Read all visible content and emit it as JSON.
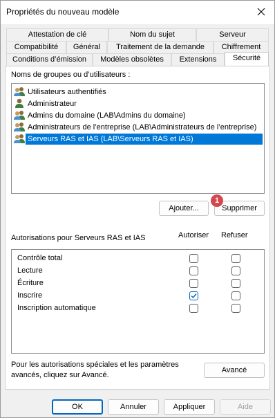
{
  "window": {
    "title": "Propriétés du nouveau modèle"
  },
  "tabs": {
    "row1": [
      "Attestation de clé",
      "Nom du sujet",
      "Serveur"
    ],
    "row2": [
      "Compatibilité",
      "Général",
      "Traitement de la demande",
      "Chiffrement"
    ],
    "row3": [
      "Conditions d’émission",
      "Modèles obsolètes",
      "Extensions",
      "Sécurité"
    ],
    "active": "Sécurité"
  },
  "groups": {
    "label": "Noms de groupes ou d’utilisateurs :",
    "items": [
      {
        "name": "Utilisateurs authentifiés",
        "icon": "users-group-icon"
      },
      {
        "name": "Administrateur",
        "icon": "user-icon"
      },
      {
        "name": "Admins du domaine (LAB\\Admins du domaine)",
        "icon": "users-group-icon"
      },
      {
        "name": "Administrateurs de l’entreprise (LAB\\Administrateurs de l’entreprise)",
        "icon": "users-group-icon"
      },
      {
        "name": "Serveurs RAS et IAS (LAB\\Serveurs RAS et IAS)",
        "icon": "users-group-icon",
        "selected": true
      }
    ],
    "add_button": "Ajouter...",
    "remove_button": "Supprimer",
    "callout_badge": "1"
  },
  "permissions": {
    "label": "Autorisations pour Serveurs RAS et IAS",
    "allow_header": "Autoriser",
    "deny_header": "Refuser",
    "rows": [
      {
        "name": "Contrôle total",
        "allow": false,
        "deny": false
      },
      {
        "name": "Lecture",
        "allow": false,
        "deny": false
      },
      {
        "name": "Écriture",
        "allow": false,
        "deny": false
      },
      {
        "name": "Inscrire",
        "allow": true,
        "deny": false
      },
      {
        "name": "Inscription automatique",
        "allow": false,
        "deny": false
      }
    ]
  },
  "advanced": {
    "text_line1": "Pour les autorisations spéciales et les paramètres",
    "text_line2": "avancés, cliquez sur Avancé.",
    "button": "Avancé"
  },
  "footer": {
    "ok": "OK",
    "cancel": "Annuler",
    "apply": "Appliquer",
    "help": "Aide"
  },
  "colors": {
    "accent": "#0067c0",
    "selection": "#0078d7",
    "badge": "#d4474c"
  }
}
